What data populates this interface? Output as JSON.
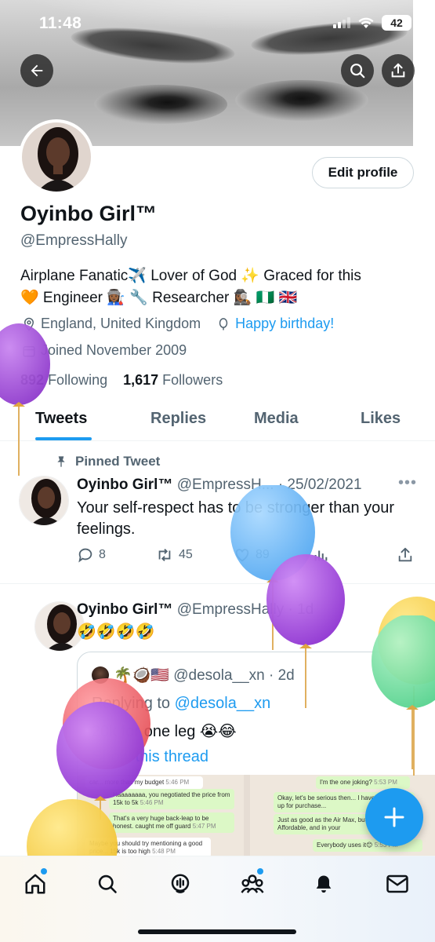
{
  "status_bar": {
    "time": "11:48",
    "battery": "42"
  },
  "profile": {
    "display_name": "Oyinbo Girl™",
    "handle": "@EmpressHally",
    "edit_button": "Edit profile",
    "bio_line1": "Airplane Fanatic✈️ Lover of God ✨ Graced for this",
    "bio_line2": "🧡 Engineer 👩🏾‍🏭 🔧 Researcher 🕵🏾‍♀️ 🇳🇬 🇬🇧",
    "location": "England, United Kingdom",
    "birthday": "Happy birthday!",
    "joined": "Joined November 2009",
    "following_count": "892",
    "following_label": "Following",
    "followers_count": "1,617",
    "followers_label": "Followers"
  },
  "tabs": [
    {
      "label": "Tweets",
      "active": true
    },
    {
      "label": "Replies",
      "active": false
    },
    {
      "label": "Media",
      "active": false
    },
    {
      "label": "Likes",
      "active": false
    }
  ],
  "pinned_label": "Pinned Tweet",
  "tweets": [
    {
      "name": "Oyinbo Girl™",
      "handle_time": "@EmpressH... · 25/02/2021",
      "text_line1": "Your self-respect has to be stronger than your",
      "text_line2": "feelings.",
      "replies": "8",
      "retweets": "45",
      "likes": "89"
    },
    {
      "name": "Oyinbo Girl™",
      "handle_time": "@EmpressHally · 1d",
      "text": "🤣🤣🤣🤣",
      "quote": {
        "header": "🌴🥥🇺🇸 @desola__xn · 2d",
        "replying_prefix": "Replying to ",
        "replying_handle": "@desola__xn",
        "text": "20k for one leg 😭😂",
        "show_thread": "Show this thread",
        "chat_left": [
          {
            "text": "car... more than my budget",
            "time": "5:46 PM",
            "dir": "in"
          },
          {
            "text": "Haaaaaaaa, you negotiated the price from 15k to 5k",
            "time": "5:46 PM",
            "dir": "out"
          },
          {
            "text": "That's a very huge back-leap to be honest. caught me off guard",
            "time": "5:47 PM",
            "dir": "out"
          },
          {
            "text": "Maybe you should try mentioning a good price... 15k is too high",
            "time": "5:48 PM",
            "dir": "in"
          }
        ],
        "chat_right": [
          {
            "text": "I'm the one joking?",
            "time": "5:53 PM",
            "dir": "out"
          },
          {
            "text": "Okay, let's be serious then... I have a footwear up for purchase...",
            "time": "",
            "dir": "out"
          },
          {
            "text": "Just as good as the Air Max, but cheap... Affordable, and in your",
            "time": "",
            "dir": "out"
          },
          {
            "text": "Everybody uses it😊",
            "time": "5:53 PM",
            "dir": "out"
          }
        ]
      }
    }
  ],
  "colors": {
    "accent": "#1d9bf0",
    "text": "#0f1419",
    "muted": "#536471"
  },
  "nav": [
    "home-icon",
    "search-icon",
    "spaces-icon",
    "communities-icon",
    "notifications-icon",
    "messages-icon"
  ]
}
